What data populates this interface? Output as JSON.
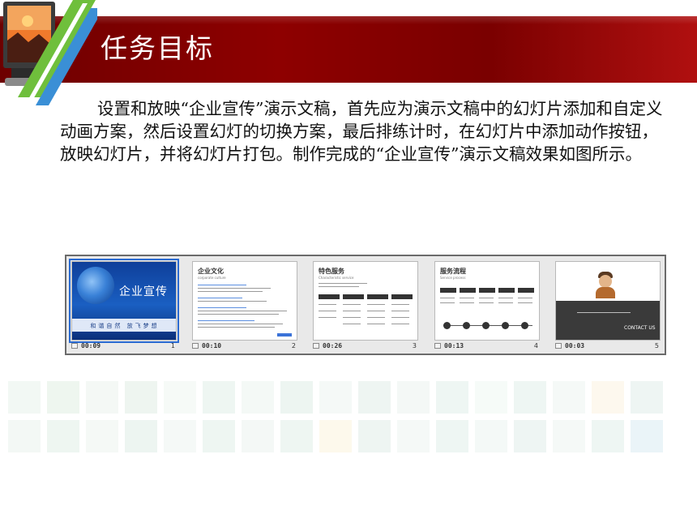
{
  "header": {
    "title": "任务目标"
  },
  "body": {
    "paragraph": "设置和放映“企业宣传”演示文稿，首先应为演示文稿中的幻灯片添加和自定义动画方案，然后设置幻灯的切换方案，最后排练计时，在幻灯片中添加动作按钮，放映幻灯片，并将幻灯片打包。制作完成的“企业宣传”演示文稿效果如图所示。"
  },
  "sorter": {
    "slides": [
      {
        "number": "1",
        "time": "00:09",
        "title": "企业宣传",
        "footer": "和谐自然 放飞梦想",
        "selected": true
      },
      {
        "number": "2",
        "time": "00:10",
        "title": "企业文化",
        "subtitle": "corporate culture"
      },
      {
        "number": "3",
        "time": "00:26",
        "title": "特色服务",
        "subtitle": "Characteristic service"
      },
      {
        "number": "4",
        "time": "00:13",
        "title": "服务流程",
        "subtitle": "Service process"
      },
      {
        "number": "5",
        "time": "00:03",
        "contact": "CONTACT US"
      }
    ]
  },
  "colors": {
    "header_red": "#8e0000",
    "selection_blue": "#2b6bd1"
  },
  "icons": [
    "monitor-logo-icon",
    "timing-icon"
  ]
}
